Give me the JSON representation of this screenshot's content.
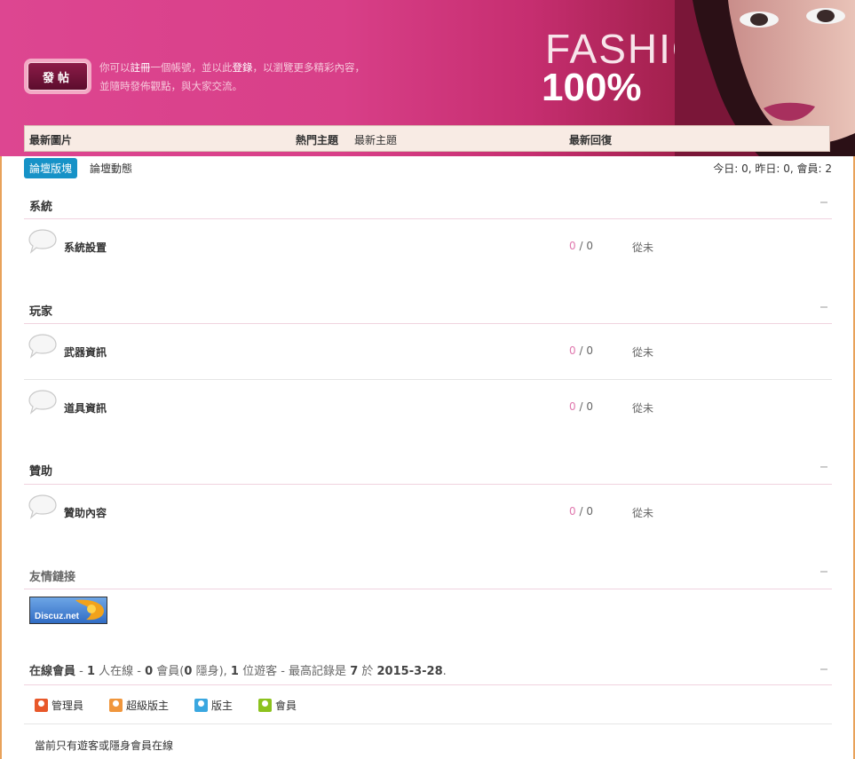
{
  "header": {
    "post_button": "發帖",
    "intro": {
      "p1": "你可以",
      "register": "註冊",
      "p2": "一個帳號，並以此",
      "login": "登錄",
      "p3": "，以瀏覽更多精彩內容，並隨時發佈觀點，與大家交流。"
    },
    "banner_word": "FASHION",
    "banner_percent": "100%"
  },
  "navbar": {
    "latest_pics": "最新圖片",
    "hot_topics": "熱門主題",
    "latest_topics": "最新主題",
    "latest_replies": "最新回復"
  },
  "tabs": {
    "active": "論壇版塊",
    "other": "論壇動態"
  },
  "stats": "今日: 0, 昨日: 0, 會員: 2",
  "categories": [
    {
      "title": "系統",
      "forums": [
        {
          "name": "系統設置",
          "threads": "0",
          "posts": "0",
          "last": "從未"
        }
      ]
    },
    {
      "title": "玩家",
      "forums": [
        {
          "name": "武器資訊",
          "threads": "0",
          "posts": "0",
          "last": "從未"
        },
        {
          "name": "道具資訊",
          "threads": "0",
          "posts": "0",
          "last": "從未"
        }
      ]
    },
    {
      "title": "贊助",
      "forums": [
        {
          "name": "贊助內容",
          "threads": "0",
          "posts": "0",
          "last": "從未"
        }
      ]
    }
  ],
  "links": {
    "title": "友情鏈接",
    "logo_text": "Discuz.net"
  },
  "online": {
    "title": "在線會員",
    "d1": " - ",
    "n1": "1",
    "t1": " 人在線 - ",
    "n2": "0",
    "t2": " 會員(",
    "n3": "0",
    "t3": " 隱身), ",
    "n4": "1",
    "t4": " 位遊客 - 最高記錄是 ",
    "n5": "7",
    "t5": " 於 ",
    "date": "2015-3-28",
    "t6": ".",
    "legend": [
      "管理員",
      "超級版主",
      "版主",
      "會員"
    ],
    "note": "當前只有遊客或隱身會員在線"
  },
  "colors": {
    "banner_pink": "#dd4691",
    "tab_blue": "#1692c7",
    "count_pink": "#e078ae",
    "legend_admin": "#e8582a",
    "legend_super": "#f0963c",
    "legend_mod": "#3aa7e0",
    "legend_member": "#8cc21e"
  }
}
